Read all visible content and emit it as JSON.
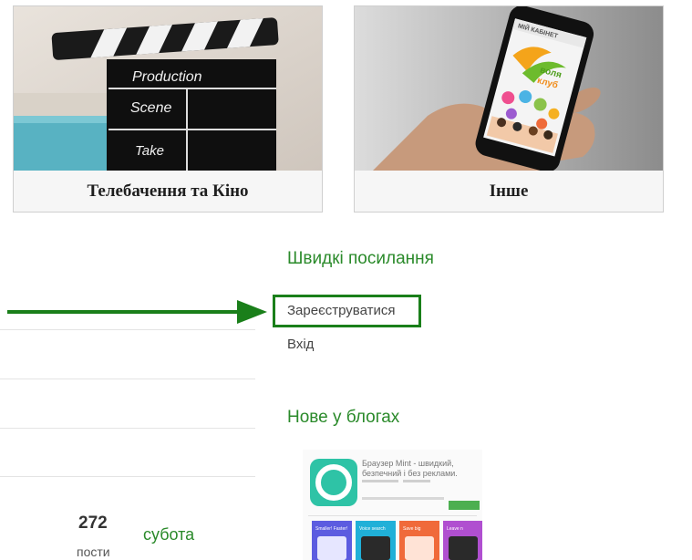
{
  "cards": [
    {
      "caption": "Телебачення та Кіно",
      "clapper": {
        "line1": "Production",
        "line2": "Scene",
        "line3": "Take"
      }
    },
    {
      "caption": "Інше",
      "phone": {
        "header": "МІЙ КАБІНЕТ",
        "logo_line1": "воля",
        "logo_line2": "клуб"
      }
    }
  ],
  "quick_links": {
    "title": "Швидкі посилання",
    "register": "Зареєструватися",
    "login": "Вхід"
  },
  "blogs": {
    "title": "Нове у блогах",
    "thumb": {
      "line1": "Браузер Mint - швидкий,",
      "line2": "безпечний і без реклами.",
      "tiles": [
        "Smaller! Faster!",
        "Voice search",
        "Save big",
        "Leave n"
      ]
    }
  },
  "stats": {
    "count": "272",
    "label": "пости",
    "day": "субота"
  },
  "colors": {
    "accent_green": "#2a8a2a",
    "arrow_green": "#1a7f1a"
  }
}
